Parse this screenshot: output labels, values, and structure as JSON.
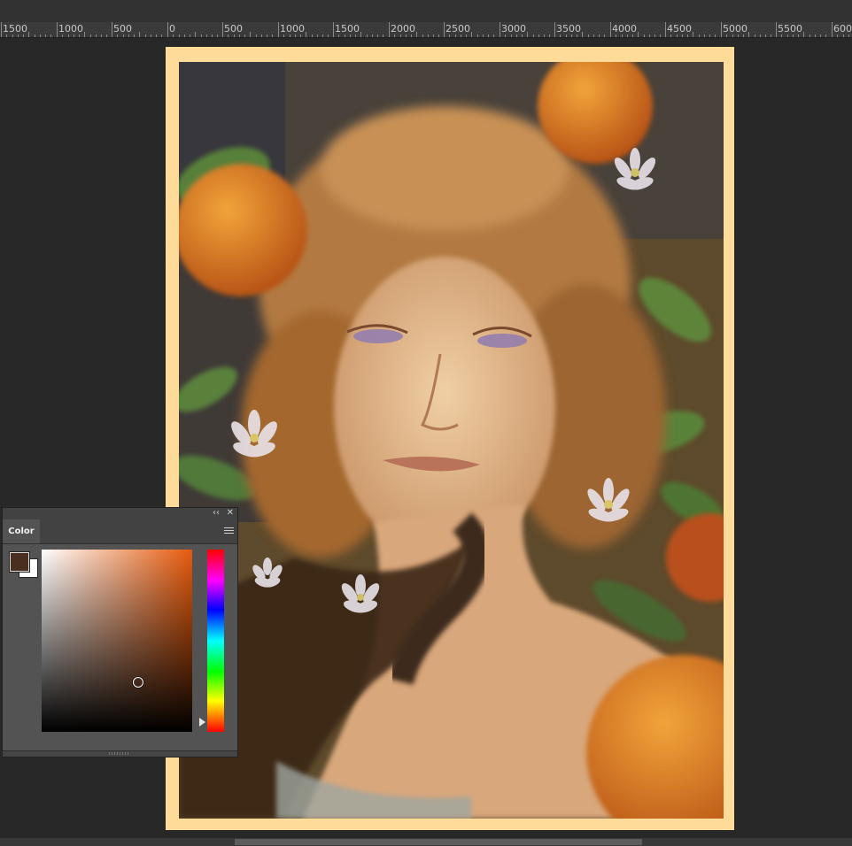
{
  "ruler": {
    "labels": [
      "1500",
      "1000",
      "500",
      "0",
      "500",
      "1000",
      "1500",
      "2000",
      "2500",
      "3000",
      "3500",
      "4000",
      "4500",
      "5000",
      "5500",
      "600"
    ]
  },
  "color_panel": {
    "tab_label": "Color",
    "collapse_glyph": "‹‹",
    "close_glyph": "✕",
    "foreground_color": "#4a2e20",
    "background_color": "#ffffff",
    "hue_color": "#e65a0c"
  },
  "colors": {
    "frame": "#ffdb99",
    "workspace": "#282828"
  }
}
